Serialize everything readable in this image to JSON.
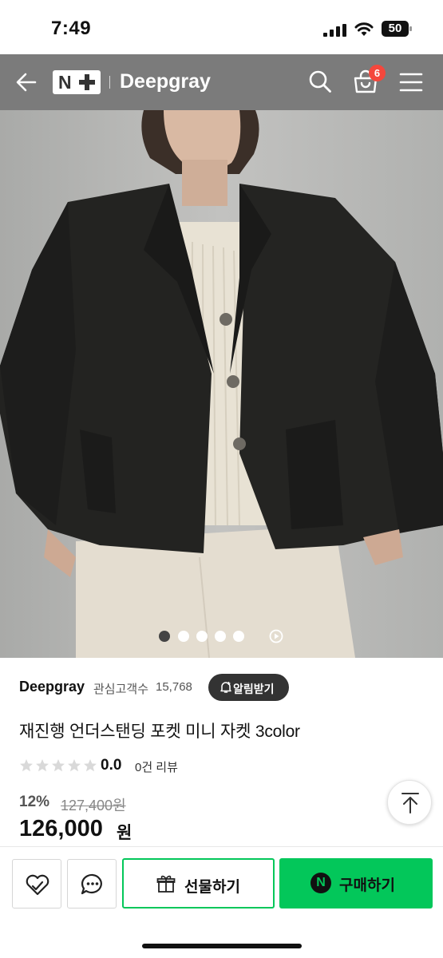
{
  "status_bar": {
    "time": "7:49",
    "battery": "50",
    "icons": [
      "signal-icon",
      "wifi-icon",
      "battery-icon"
    ]
  },
  "header": {
    "logo_text": "N",
    "brand": "Deepgray",
    "cart_count": "6",
    "icons": [
      "back-arrow-icon",
      "search-icon",
      "shopping-bag-icon",
      "hamburger-menu-icon"
    ],
    "background": "#7b7b7b"
  },
  "gallery": {
    "image_count": 5,
    "active_index": 0,
    "has_video": true
  },
  "store": {
    "name": "Deepgray",
    "follower_label": "관심고객수",
    "follower_count": "15,768",
    "alarm_label": "알림받기"
  },
  "product": {
    "title": "재진행 언더스탠딩 포켓 미니 자켓 3color",
    "rating": "0.0",
    "rating_stars": 0,
    "review_count": "0건 리뷰",
    "discount": "12%",
    "original_price": "127,400원",
    "price": "126,000",
    "price_unit": "원"
  },
  "bottom_bar": {
    "gift_label": "선물하기",
    "buy_label": "구매하기",
    "buy_icon_text": "N",
    "accent": "#03c75a"
  }
}
